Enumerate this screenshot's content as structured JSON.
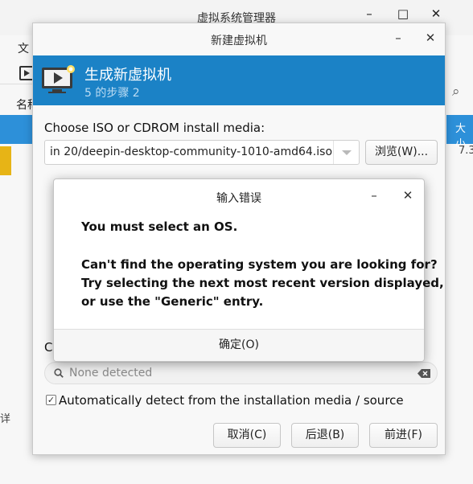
{
  "main_window": {
    "title": "虚拟系统管理器",
    "menu_file": "文",
    "column_name": "名称",
    "right_column": "大小",
    "right_value": "7.3",
    "left_bottom_text": "详"
  },
  "new_vm_dialog": {
    "title": "新建虚拟机",
    "header": {
      "title": "生成新虚拟机",
      "step": "5 的步骤 2"
    },
    "iso_label": "Choose ISO or CDROM install media:",
    "iso_value": "in 20/deepin-desktop-community-1010-amd64.iso",
    "browse_label": "浏览(W)...",
    "os_label_stub": "C",
    "os_search_placeholder": "None detected",
    "auto_detect": {
      "checked": true,
      "check_mark": "✓",
      "label": "Automatically detect from the installation media / source"
    },
    "buttons": {
      "cancel": "取消(C)",
      "back": "后退(B)",
      "forward": "前进(F)"
    }
  },
  "error_dialog": {
    "title": "输入错误",
    "primary": "You must select an OS.",
    "secondary_lines": [
      "Can't find the operating system you are looking for?",
      "Try selecting the next most recent version displayed,",
      "or use the \"Generic\" entry."
    ],
    "ok_label": "确定(O)"
  },
  "window_controls": {
    "minimize": "–",
    "maximize": "□",
    "close": "✕"
  },
  "colors": {
    "header_blue": "#1b82c6",
    "selection_blue": "#2d90d9",
    "accent_yellow": "#e7b416"
  }
}
